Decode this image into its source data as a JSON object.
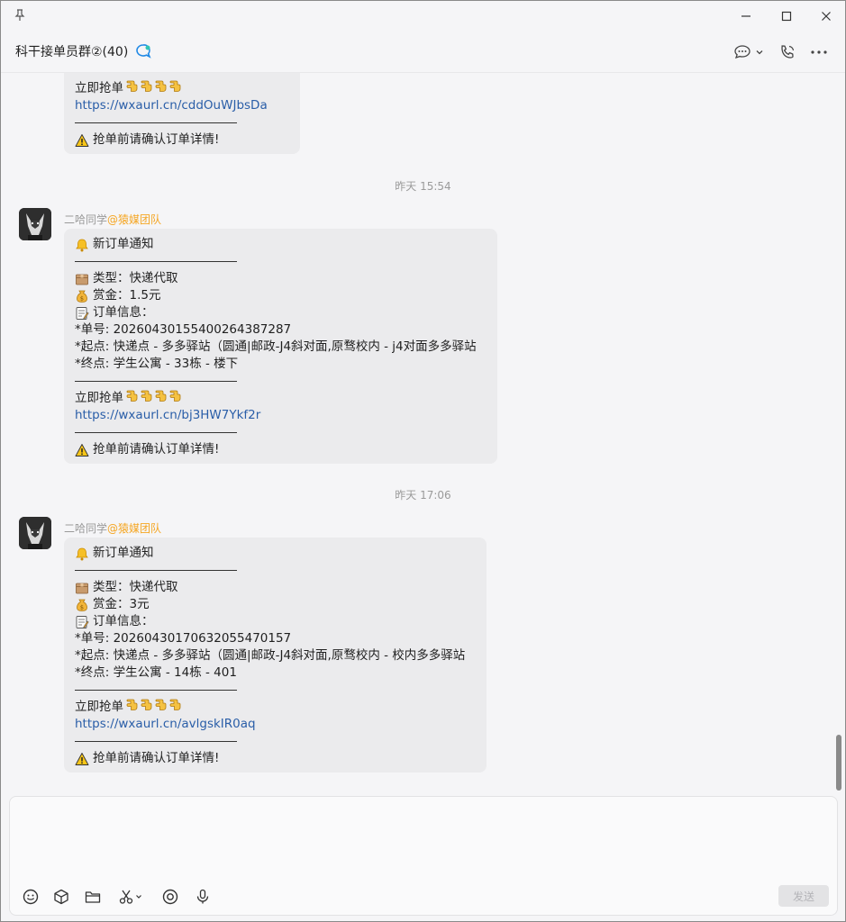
{
  "window": {
    "controls": [
      "minimize",
      "maximize",
      "close"
    ]
  },
  "header": {
    "title": "科干接单员群②(40)"
  },
  "messages": [
    {
      "partial": true,
      "grab": "立即抢单",
      "link": "https://wxaurl.cn/cddOuWJbsDa",
      "warning": "抢单前请确认订单详情!"
    },
    {
      "timestamp": "昨天 15:54",
      "sender_name": "二哈同学",
      "sender_tag": "@猿媒团队",
      "notify": "新订单通知",
      "type_line": "类型：快递代取",
      "reward_line": "赏金：1.5元",
      "info_line": "订单信息：",
      "order_no": "*单号: 20260430155400264387287",
      "start": "*起点: 快递点 - 多多驿站（圆通|邮政-J4斜对面,原骛校内 - j4对面多多驿站",
      "end": "*终点: 学生公寓 - 33栋 - 楼下",
      "grab": "立即抢单",
      "link": "https://wxaurl.cn/bj3HW7Ykf2r",
      "warning": "抢单前请确认订单详情!"
    },
    {
      "timestamp": "昨天 17:06",
      "sender_name": "二哈同学",
      "sender_tag": "@猿媒团队",
      "notify": "新订单通知",
      "type_line": "类型：快递代取",
      "reward_line": "赏金：3元",
      "info_line": "订单信息：",
      "order_no": "*单号: 20260430170632055470157",
      "start": "*起点: 快递点 - 多多驿站（圆通|邮政-J4斜对面,原骛校内 - 校内多多驿站",
      "end": "*终点: 学生公寓 - 14栋 - 401",
      "grab": "立即抢单",
      "link": "https://wxaurl.cn/avlgskIR0aq",
      "warning": "抢单前请确认订单详情!"
    }
  ],
  "input": {
    "send_label": "发送",
    "tools": [
      "emoji-icon",
      "box-icon",
      "folder-icon",
      "scissors-icon",
      "at-icon",
      "mic-icon"
    ]
  },
  "colors": {
    "link": "#2a5ea8",
    "sender_tag": "#f5a623",
    "bubble_bg": "#ebebed"
  }
}
